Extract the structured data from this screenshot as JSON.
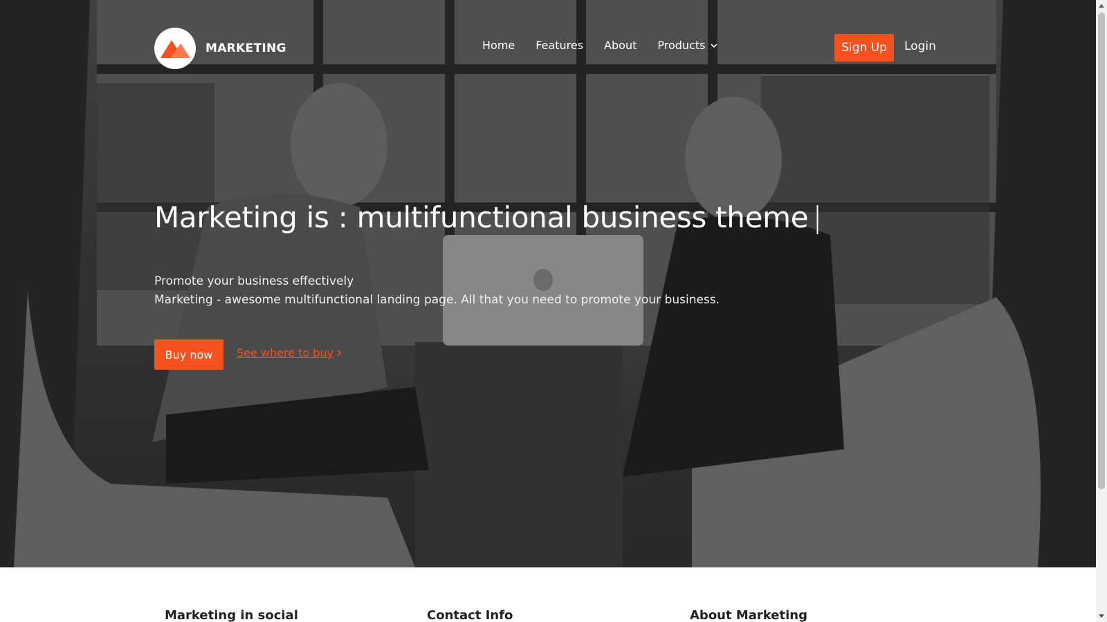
{
  "brand": {
    "name": "MARKETING",
    "color": "#f4511e"
  },
  "nav": {
    "items": [
      {
        "label": "Home"
      },
      {
        "label": "Features"
      },
      {
        "label": "About"
      },
      {
        "label": "Products",
        "has_dropdown": true
      }
    ],
    "signup_label": "Sign Up",
    "login_label": "Login"
  },
  "hero": {
    "headline": "Marketing is : multifunctional business theme",
    "cursor": "|",
    "subtitle_line1": "Promote your business effectively",
    "subtitle_line2": "Marketing - awesome multifunctional landing page. All that you need to promote your business.",
    "buy_label": "Buy now",
    "where_label": "See where to buy"
  },
  "footer": {
    "col1_title": "Marketing in social",
    "col2_title": "Contact Info",
    "col3_title": "About Marketing"
  },
  "icons": {
    "logo": "mountain-logo-icon",
    "dropdown": "chevron-down-icon",
    "link_arrow": "chevron-right-icon"
  }
}
